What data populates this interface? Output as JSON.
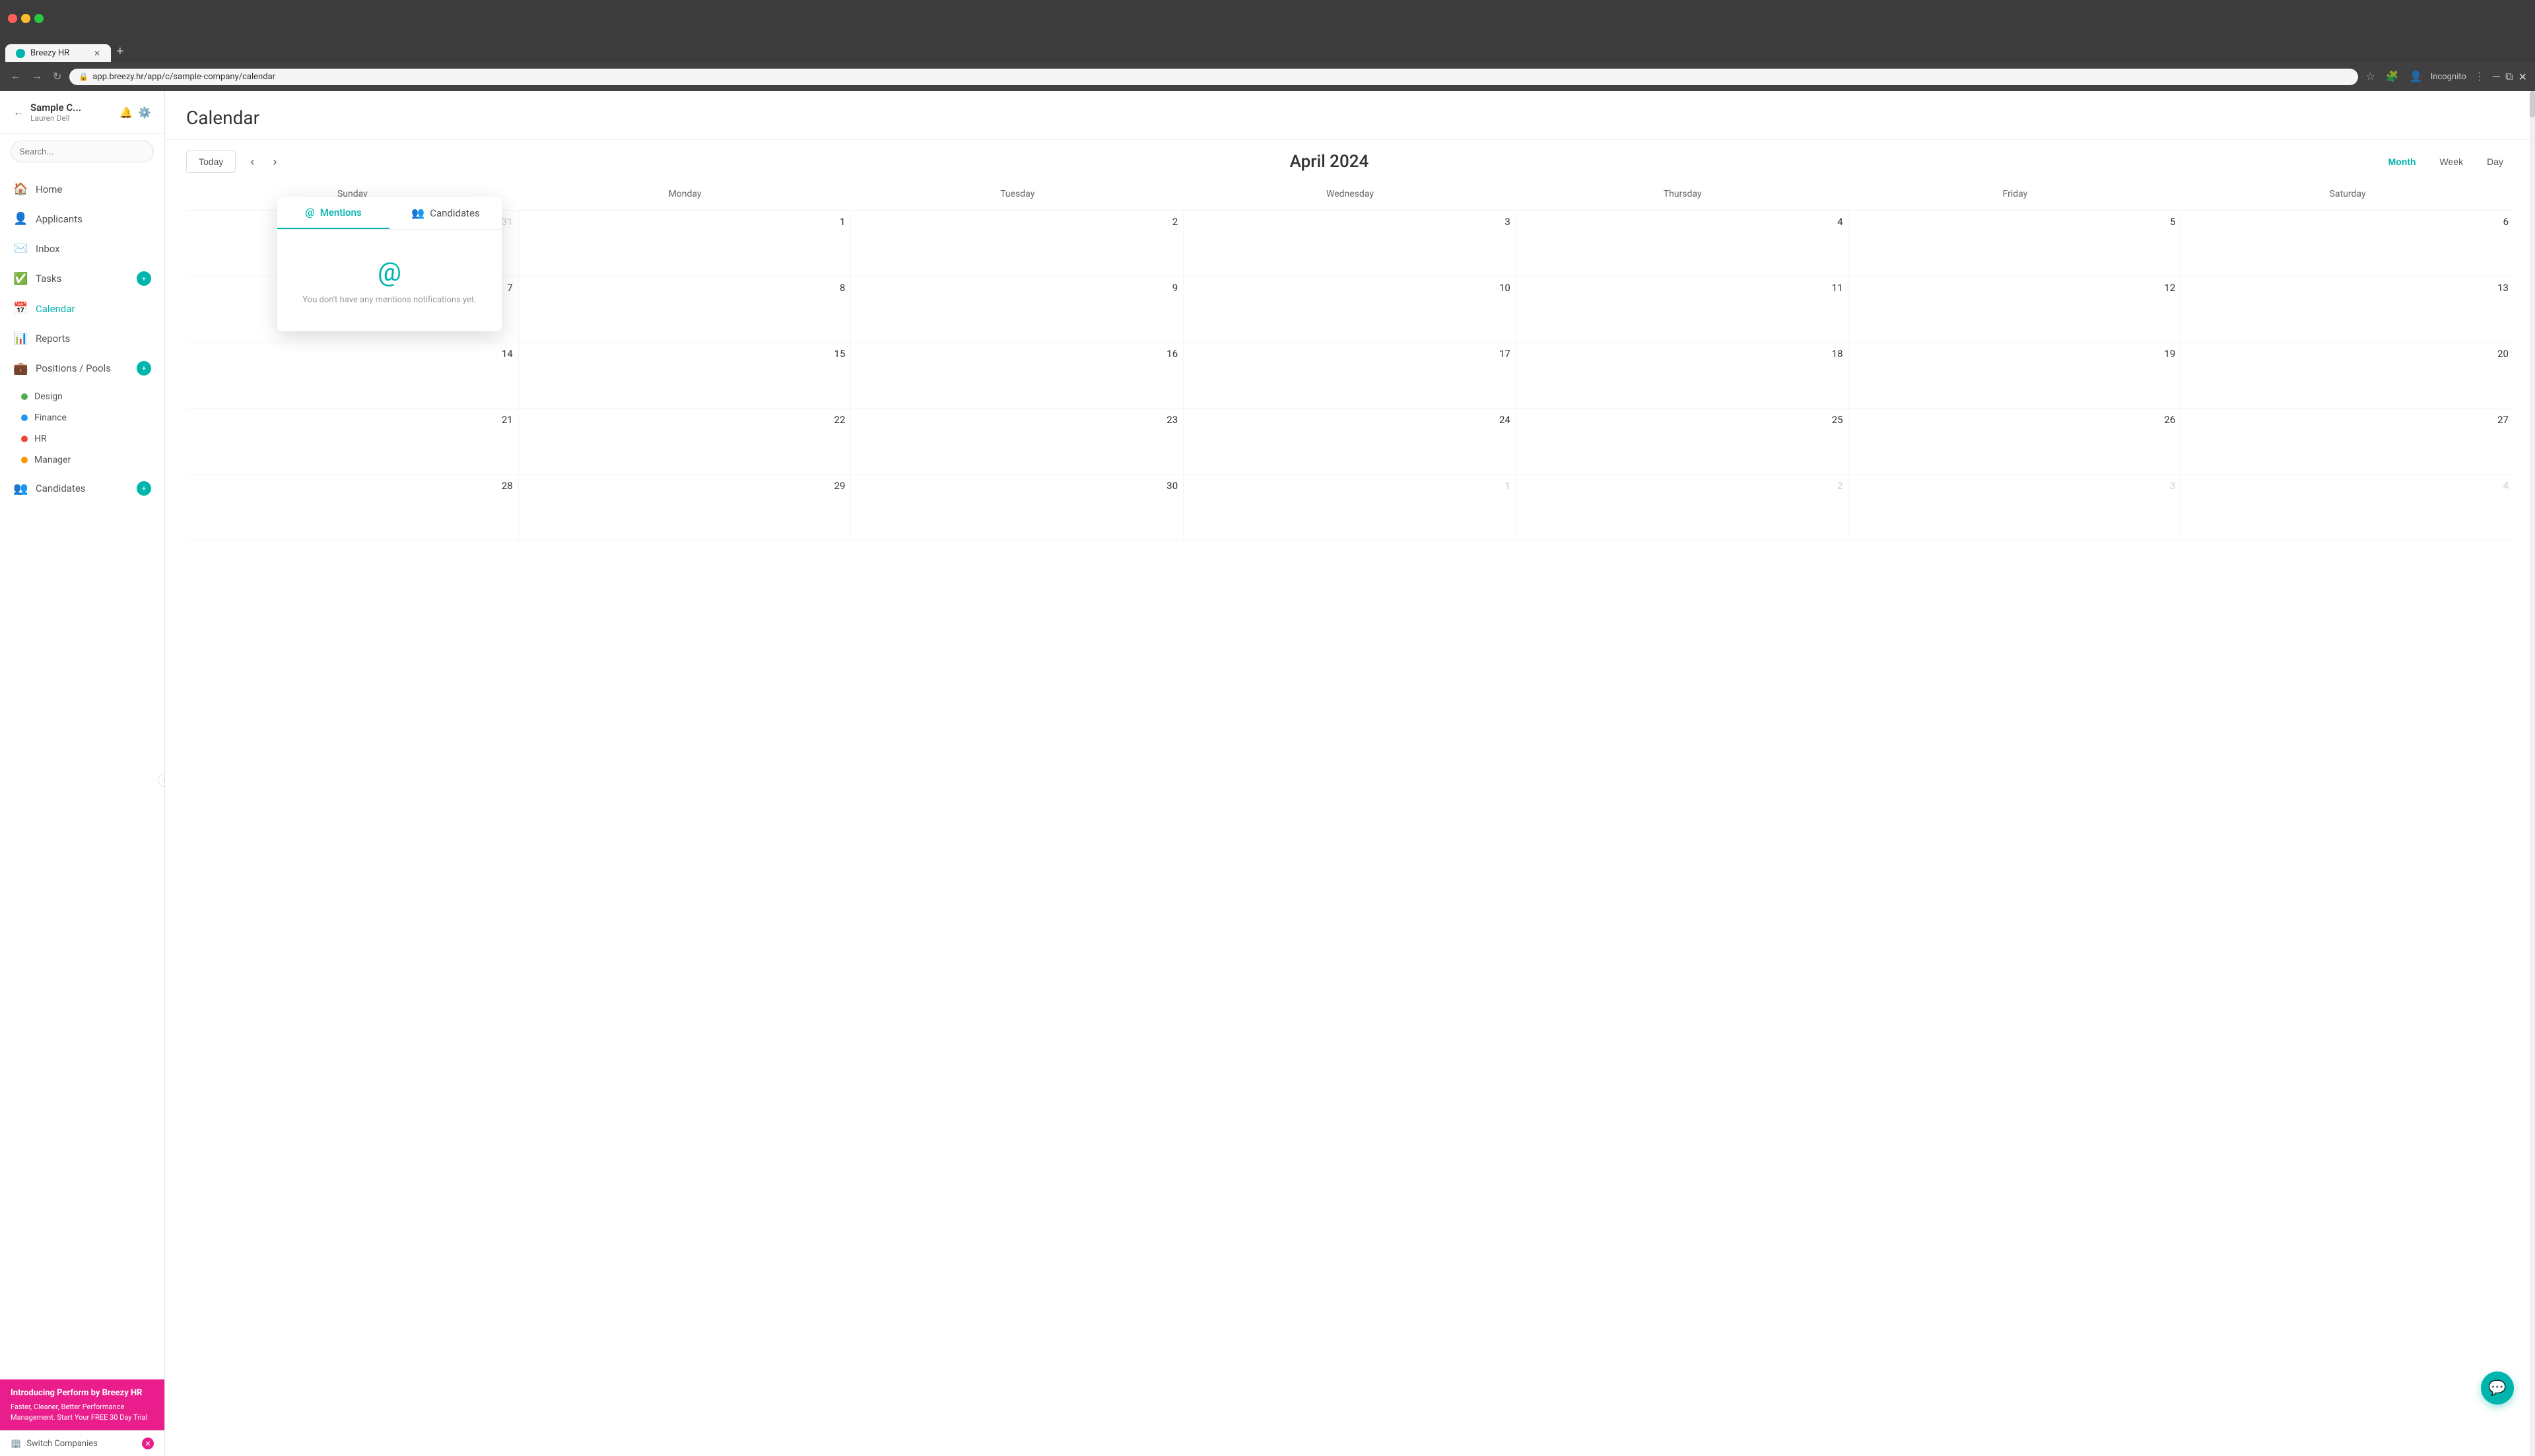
{
  "browser": {
    "tab_title": "Breezy HR",
    "url": "app.breezy.hr/app/c/sample-company/calendar",
    "incognito_label": "Incognito"
  },
  "sidebar": {
    "company_name": "Sample C...",
    "user_name": "Lauren Dell",
    "search_placeholder": "Search...",
    "nav_items": [
      {
        "id": "home",
        "label": "Home",
        "icon": "🏠",
        "badge": null
      },
      {
        "id": "applicants",
        "label": "Applicants",
        "icon": "👤",
        "badge": null
      },
      {
        "id": "inbox",
        "label": "Inbox",
        "icon": "✉️",
        "badge": null
      },
      {
        "id": "tasks",
        "label": "Tasks",
        "icon": "✅",
        "badge": "+"
      },
      {
        "id": "calendar",
        "label": "Calendar",
        "icon": "📅",
        "badge": null
      },
      {
        "id": "reports",
        "label": "Reports",
        "icon": "📊",
        "badge": null
      },
      {
        "id": "positions",
        "label": "Positions / Pools",
        "icon": "💼",
        "badge": "+"
      }
    ],
    "positions": [
      {
        "name": "Design",
        "color": "dot-green"
      },
      {
        "name": "Finance",
        "color": "dot-blue"
      },
      {
        "name": "HR",
        "color": "dot-red"
      },
      {
        "name": "Manager",
        "color": "dot-orange"
      }
    ],
    "candidates_label": "Candidates",
    "candidates_badge": "+",
    "promo_title": "Introducing Perform by Breezy HR",
    "promo_text": "Faster, Cleaner, Better Performance Management. Start Your FREE 30 Day Trial",
    "switch_companies": "Switch Companies"
  },
  "calendar": {
    "title": "Calendar",
    "today_btn": "Today",
    "month_year": "April 2024",
    "view_month": "Month",
    "view_week": "Week",
    "view_day": "Day",
    "day_headers": [
      "Sunday",
      "Monday",
      "Tuesday",
      "Wednesday",
      "Thursday",
      "Friday",
      "Saturday"
    ],
    "weeks": [
      [
        {
          "num": "31",
          "other": true
        },
        {
          "num": "1",
          "other": false
        },
        {
          "num": "2",
          "other": false
        },
        {
          "num": "3",
          "other": false
        },
        {
          "num": "4",
          "other": false
        },
        {
          "num": "5",
          "other": false
        },
        {
          "num": "6",
          "other": false
        }
      ],
      [
        {
          "num": "7",
          "other": false
        },
        {
          "num": "8",
          "other": false
        },
        {
          "num": "9",
          "other": false
        },
        {
          "num": "10",
          "other": false
        },
        {
          "num": "11",
          "other": false
        },
        {
          "num": "12",
          "other": false
        },
        {
          "num": "13",
          "other": false
        }
      ],
      [
        {
          "num": "14",
          "other": false
        },
        {
          "num": "15",
          "other": false
        },
        {
          "num": "16",
          "other": false
        },
        {
          "num": "17",
          "other": false
        },
        {
          "num": "18",
          "other": false
        },
        {
          "num": "19",
          "other": false
        },
        {
          "num": "20",
          "other": false
        }
      ],
      [
        {
          "num": "21",
          "other": false
        },
        {
          "num": "22",
          "other": false
        },
        {
          "num": "23",
          "other": false
        },
        {
          "num": "24",
          "other": false
        },
        {
          "num": "25",
          "other": false
        },
        {
          "num": "26",
          "other": false
        },
        {
          "num": "27",
          "other": false
        }
      ],
      [
        {
          "num": "28",
          "other": false
        },
        {
          "num": "29",
          "other": false
        },
        {
          "num": "30",
          "other": false
        },
        {
          "num": "1",
          "other": true
        },
        {
          "num": "2",
          "other": true
        },
        {
          "num": "3",
          "other": true
        },
        {
          "num": "4",
          "other": true
        }
      ]
    ]
  },
  "notification": {
    "tabs": [
      {
        "id": "mentions",
        "label": "Mentions",
        "icon": "@",
        "active": true
      },
      {
        "id": "candidates",
        "label": "Candidates",
        "icon": "👥",
        "active": false
      }
    ],
    "empty_text": "You don't have any mentions notifications yet."
  }
}
